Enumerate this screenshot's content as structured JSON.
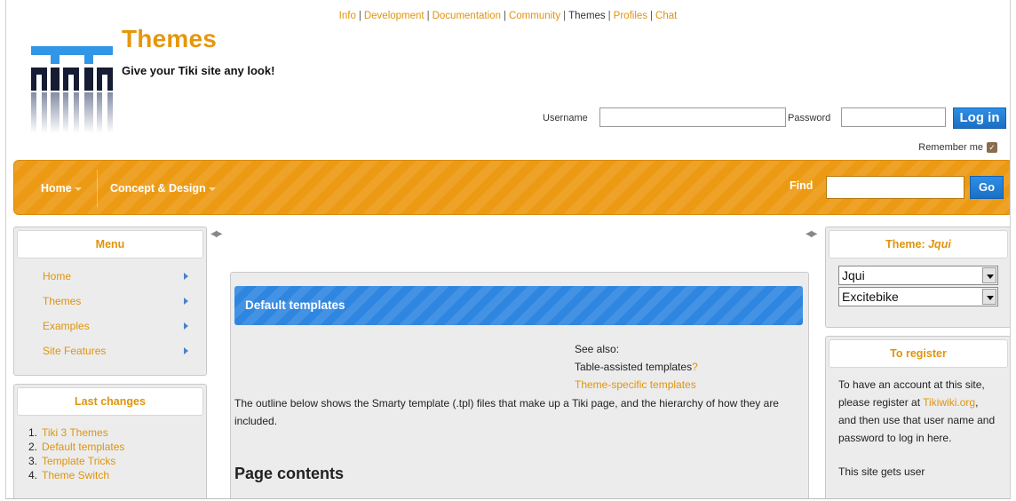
{
  "topnav": {
    "items": [
      {
        "label": "Info"
      },
      {
        "label": "Development"
      },
      {
        "label": "Documentation"
      },
      {
        "label": "Community"
      },
      {
        "label": "Themes"
      },
      {
        "label": "Profiles"
      },
      {
        "label": "Chat"
      }
    ],
    "separator": "|"
  },
  "site": {
    "title": "Themes",
    "tagline": "Give your Tiki site any look!"
  },
  "login": {
    "username_label": "Username",
    "password_label": "Password",
    "username_value": "",
    "password_value": "",
    "button": "Log in",
    "remember_label": "Remember me",
    "remember_checked": true
  },
  "navbar": {
    "items": [
      {
        "label": "Home"
      },
      {
        "label": "Concept & Design"
      }
    ],
    "find_label": "Find",
    "find_value": "",
    "go_button": "Go",
    "color": "#ec9a13"
  },
  "menu": {
    "title": "Menu",
    "items": [
      {
        "label": "Home"
      },
      {
        "label": "Themes"
      },
      {
        "label": "Examples"
      },
      {
        "label": "Site Features"
      }
    ]
  },
  "last_changes": {
    "title": "Last changes",
    "items": [
      {
        "num": "1.",
        "label": "Tiki 3 Themes"
      },
      {
        "num": "2.",
        "label": "Default templates"
      },
      {
        "num": "3.",
        "label": "Template Tricks"
      },
      {
        "num": "4.",
        "label": "Theme Switch"
      }
    ]
  },
  "content": {
    "heading": "Default templates",
    "see_also_label": "See also:",
    "see_also_1": "Table-assisted templates",
    "see_also_1_marker": "?",
    "see_also_2": "Theme-specific templates",
    "intro": "The outline below shows the Smarty template (.tpl) files that make up a Tiki page, and the hierarchy of how they are included.",
    "section_title": "Page contents",
    "heading_color": "#2f86e0"
  },
  "theme_module": {
    "title": "Theme: ",
    "title_value": "Jqui",
    "theme_select": "Jqui",
    "option_select": "Excitebike"
  },
  "register_module": {
    "title": "To register",
    "text_1": "To have an account at this site, please register at ",
    "link": "Tikiwiki.org",
    "text_2": ", and then use that user name and password to log in here.",
    "text_3": "This site gets user"
  },
  "icons": {
    "logo": "tiki-logo",
    "menu_arrow": "triangle-right-icon",
    "toggle": "column-toggle-icon"
  }
}
